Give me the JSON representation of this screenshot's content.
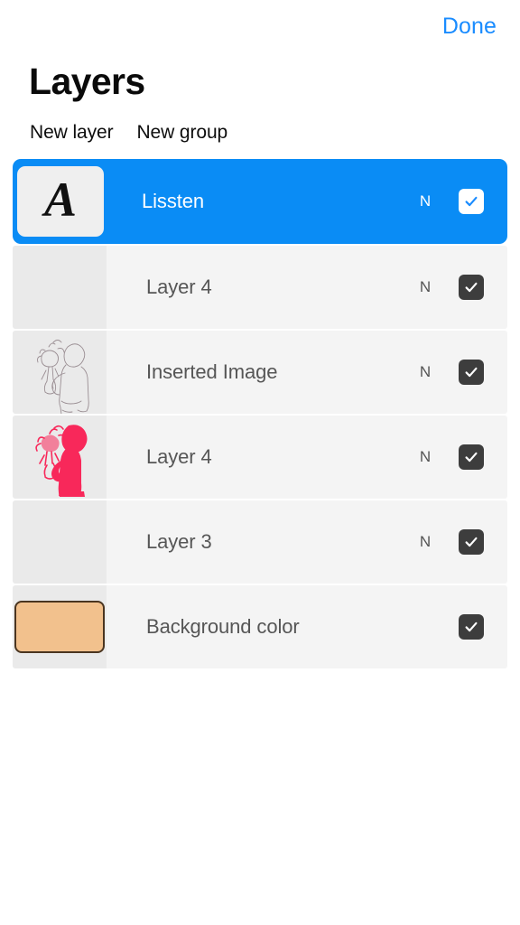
{
  "topbar": {
    "done_label": "Done"
  },
  "header": {
    "title": "Layers"
  },
  "actions": {
    "new_layer_label": "New layer",
    "new_group_label": "New group"
  },
  "colors": {
    "accent_blue": "#0a8cf5",
    "done_blue": "#1a8cff",
    "row_background": "#f4f4f4",
    "thumb_background": "#eaeaea",
    "checkbox_dark": "#3d3d3d",
    "background_swatch": "#f2c18d",
    "swatch_border": "#4a3520",
    "silhouette_pink": "#f8285a",
    "lineart_gray": "#9a8e93"
  },
  "layers": [
    {
      "name": "Lissten",
      "blend_mode": "N",
      "visible": true,
      "selected": true,
      "thumb_type": "text-glyph",
      "thumb_glyph": "A"
    },
    {
      "name": "Layer 4",
      "blend_mode": "N",
      "visible": true,
      "selected": false,
      "thumb_type": "empty",
      "thumb_glyph": ""
    },
    {
      "name": "Inserted Image",
      "blend_mode": "N",
      "visible": true,
      "selected": false,
      "thumb_type": "lineart-figure",
      "thumb_glyph": ""
    },
    {
      "name": "Layer 4",
      "blend_mode": "N",
      "visible": true,
      "selected": false,
      "thumb_type": "pink-silhouette",
      "thumb_glyph": ""
    },
    {
      "name": "Layer 3",
      "blend_mode": "N",
      "visible": true,
      "selected": false,
      "thumb_type": "empty",
      "thumb_glyph": ""
    },
    {
      "name": "Background color",
      "blend_mode": "",
      "visible": true,
      "selected": false,
      "thumb_type": "color-swatch",
      "thumb_glyph": ""
    }
  ]
}
